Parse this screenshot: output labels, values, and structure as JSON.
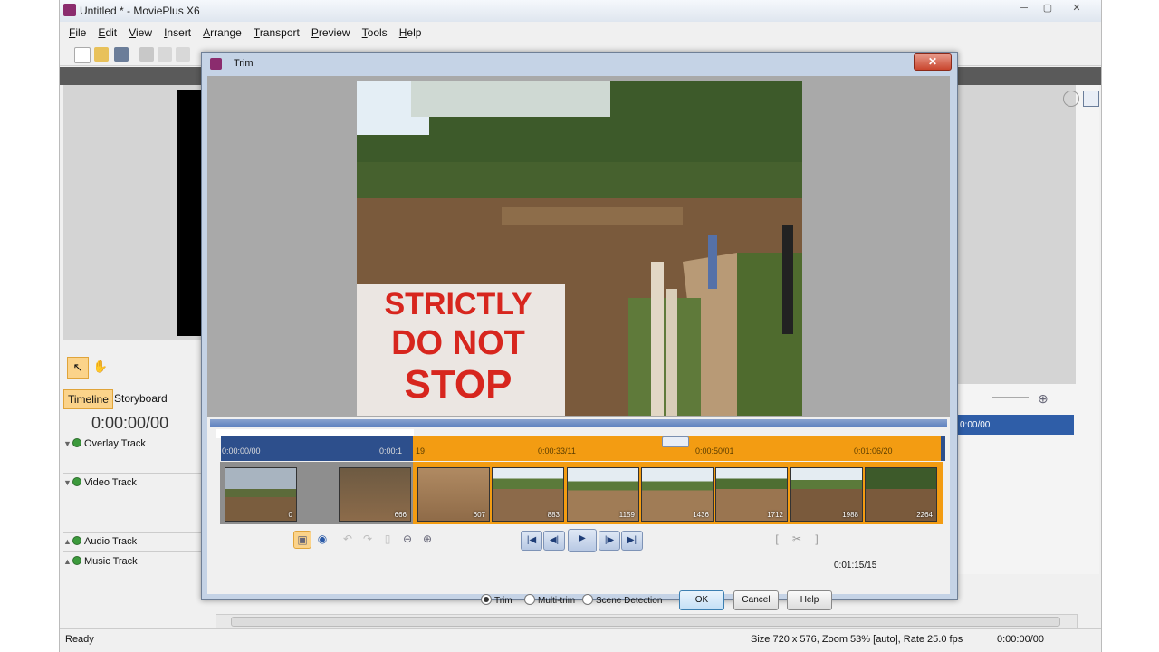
{
  "app": {
    "title": "Untitled * - MoviePlus X6",
    "menus": [
      "File",
      "Edit",
      "View",
      "Insert",
      "Arrange",
      "Transport",
      "Preview",
      "Tools",
      "Help"
    ],
    "window_controls": [
      "─",
      "▢",
      "✕"
    ]
  },
  "left_panel": {
    "tabs": [
      "Timeline",
      "Storyboard"
    ],
    "timecode": "0:00:00/00",
    "tracks": [
      "Overlay Track",
      "Video Track",
      "Audio Track",
      "Music Track"
    ]
  },
  "right_panel": {
    "time": "0:00/00"
  },
  "status": {
    "ready": "Ready",
    "info": "Size 720 x 576, Zoom 53% [auto], Rate 25.0 fps",
    "timecode": "0:00:00/00"
  },
  "dialog": {
    "title": "Trim",
    "close": "✕",
    "ruler_ticks": [
      "0:00:00/00",
      "0:00:1",
      "19",
      "0:00:33/11",
      "0:00:50/01",
      "0:01:06/20"
    ],
    "thumbnails": [
      "0",
      "666",
      "607",
      "883",
      "1159",
      "1436",
      "1712",
      "1988",
      "2264"
    ],
    "duration": "0:01:15/15",
    "mode_options": [
      {
        "label": "Trim",
        "selected": true
      },
      {
        "label": "Multi-trim",
        "selected": false
      },
      {
        "label": "Scene Detection",
        "selected": false
      }
    ],
    "buttons": {
      "ok": "OK",
      "cancel": "Cancel",
      "help": "Help"
    },
    "sign_line1": "STRICTLY",
    "sign_line2": "DO NOT",
    "sign_line3": "STOP"
  },
  "colors": {
    "accent_orange": "#f39c12",
    "ruler_blue": "#2d4f8c",
    "app_icon": "#8b2c6e"
  }
}
